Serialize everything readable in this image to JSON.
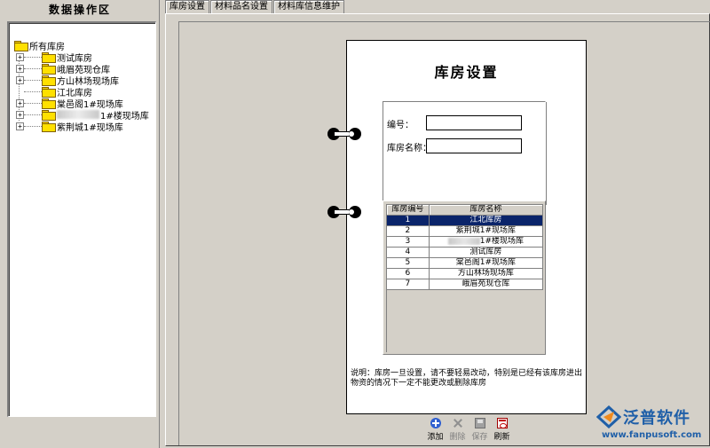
{
  "left_panel": {
    "title": "数据操作区",
    "tree": {
      "root": "所有库房",
      "nodes": [
        {
          "label": "测试库房",
          "expandable": true
        },
        {
          "label": "峨眉苑现仓库",
          "expandable": true
        },
        {
          "label": "方山林场现场库",
          "expandable": true
        },
        {
          "label": "江北库房",
          "expandable": false
        },
        {
          "label": "棠邑阁1#现场库",
          "expandable": true
        },
        {
          "label": "1#楼现场库",
          "expandable": true
        },
        {
          "label": "紫荆城1#现场库",
          "expandable": true
        }
      ]
    }
  },
  "tabs": [
    {
      "label": "库房设置",
      "active": true
    },
    {
      "label": "材料品名设置",
      "active": false
    },
    {
      "label": "材料库信息维护",
      "active": false
    }
  ],
  "card": {
    "title": "库房设置",
    "form": {
      "code_label": "编号：",
      "code_value": "",
      "name_label": "库房名称：",
      "name_value": ""
    },
    "grid": {
      "columns": [
        "库房编号",
        "库房名称"
      ],
      "rows": [
        {
          "no": "1",
          "name": "江北库房",
          "selected": true
        },
        {
          "no": "2",
          "name": "紫荆城1#现场库",
          "selected": false
        },
        {
          "no": "3",
          "name": "1#楼现场库",
          "selected": false
        },
        {
          "no": "4",
          "name": "测试库房",
          "selected": false
        },
        {
          "no": "5",
          "name": "棠邑阁1#现场库",
          "selected": false
        },
        {
          "no": "6",
          "name": "方山林场现场库",
          "selected": false
        },
        {
          "no": "7",
          "name": "峨眉苑现仓库",
          "selected": false
        }
      ]
    },
    "note": "说明：库房一旦设置，请不要轻易改动，特别是已经有该库房进出物资的情况下一定不能更改或删除库房"
  },
  "toolbar": {
    "add_label": "添加",
    "delete_label": "删除",
    "save_label": "保存",
    "refresh_label": "刷新"
  },
  "logo": {
    "text": "泛普软件",
    "url": "www.fanpusoft.com"
  },
  "colors": {
    "selection": "#0a246a",
    "window_bg": "#d4d0c8",
    "logo_blue": "#1f5fa8"
  }
}
